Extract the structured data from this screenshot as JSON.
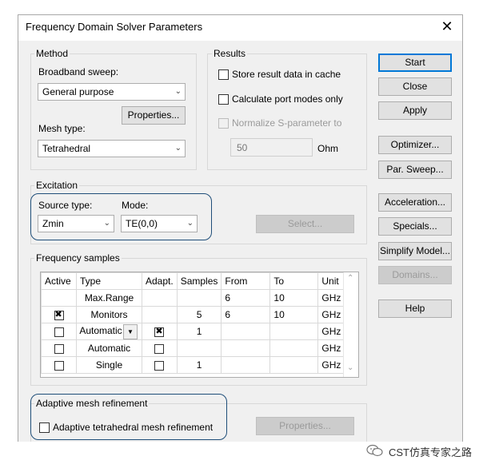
{
  "window": {
    "title": "Frequency Domain Solver Parameters",
    "close_glyph": "✕"
  },
  "method": {
    "legend": "Method",
    "broadband_label": "Broadband sweep:",
    "broadband_value": "General purpose",
    "properties_label": "Properties...",
    "mesh_label": "Mesh type:",
    "mesh_value": "Tetrahedral"
  },
  "results": {
    "legend": "Results",
    "store_label": "Store result data in cache",
    "store_checked": false,
    "port_modes_label": "Calculate port modes only",
    "port_modes_checked": false,
    "normalize_label": "Normalize S-parameter to",
    "normalize_checked": false,
    "ohm_value": "50",
    "ohm_unit": "Ohm"
  },
  "excitation": {
    "legend": "Excitation",
    "source_label": "Source type:",
    "source_value": "Zmin",
    "mode_label": "Mode:",
    "mode_value": "TE(0,0)",
    "select_label": "Select..."
  },
  "frequency_samples": {
    "legend": "Frequency samples",
    "columns": [
      "Active",
      "Type",
      "Adapt.",
      "Samples",
      "From",
      "To",
      "Unit"
    ],
    "rows": [
      {
        "active": "",
        "type": "Max.Range",
        "adapt": "",
        "samples": "",
        "from": "6",
        "to": "10",
        "unit": "GHz"
      },
      {
        "active": "checked",
        "type": "Monitors",
        "adapt": "",
        "samples": "5",
        "from": "6",
        "to": "10",
        "unit": "GHz"
      },
      {
        "active": "unchecked",
        "type": "Automatic",
        "adapt": "checked",
        "samples": "1",
        "from": "",
        "to": "",
        "unit": "GHz"
      },
      {
        "active": "unchecked",
        "type": "Automatic",
        "adapt": "unchecked",
        "samples": "",
        "from": "",
        "to": "",
        "unit": "GHz"
      },
      {
        "active": "unchecked",
        "type": "Single",
        "adapt": "unchecked",
        "samples": "1",
        "from": "",
        "to": "",
        "unit": "GHz"
      }
    ]
  },
  "adaptive": {
    "legend": "Adaptive mesh refinement",
    "checkbox_label": "Adaptive tetrahedral mesh refinement",
    "checked": false,
    "properties_label": "Properties..."
  },
  "side_buttons": {
    "start": "Start",
    "close": "Close",
    "apply": "Apply",
    "optimizer": "Optimizer...",
    "par_sweep": "Par. Sweep...",
    "acceleration": "Acceleration...",
    "specials": "Specials...",
    "simplify": "Simplify Model...",
    "domains": "Domains...",
    "help": "Help"
  },
  "watermark": {
    "text": "CST仿真专家之路"
  },
  "colors": {
    "highlight": "#1f4e79",
    "default_button_border": "#0078d7"
  }
}
